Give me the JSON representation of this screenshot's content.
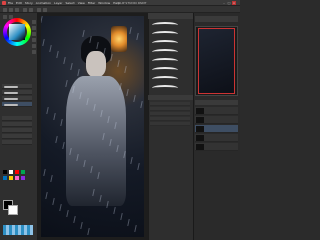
{
  "window": {
    "title": "CLIP STUDIO PAINT",
    "menus": [
      "File",
      "Edit",
      "Story",
      "Animation",
      "Layer",
      "Select",
      "View",
      "Filter",
      "Window",
      "Help"
    ]
  },
  "colors": {
    "main_color": "#2d8fc4",
    "accent_selection": "#3e4e63",
    "navigator_frame": "#cc3333"
  },
  "left_panel": {
    "palette_swatches": [
      "#000000",
      "#ffffff",
      "#ff0000",
      "#00a651",
      "#0072bc",
      "#ffcc00",
      "#ff66cc",
      "#8a2be2"
    ]
  },
  "brush_panel": {
    "stroke_count": 8
  },
  "right_panel": {
    "layers_count": 5
  },
  "icons": [
    "color-wheel-icon",
    "brush-icon",
    "eraser-icon",
    "pen-icon",
    "hand-icon",
    "zoom-icon",
    "minimize-icon",
    "maximize-icon",
    "close-icon"
  ]
}
